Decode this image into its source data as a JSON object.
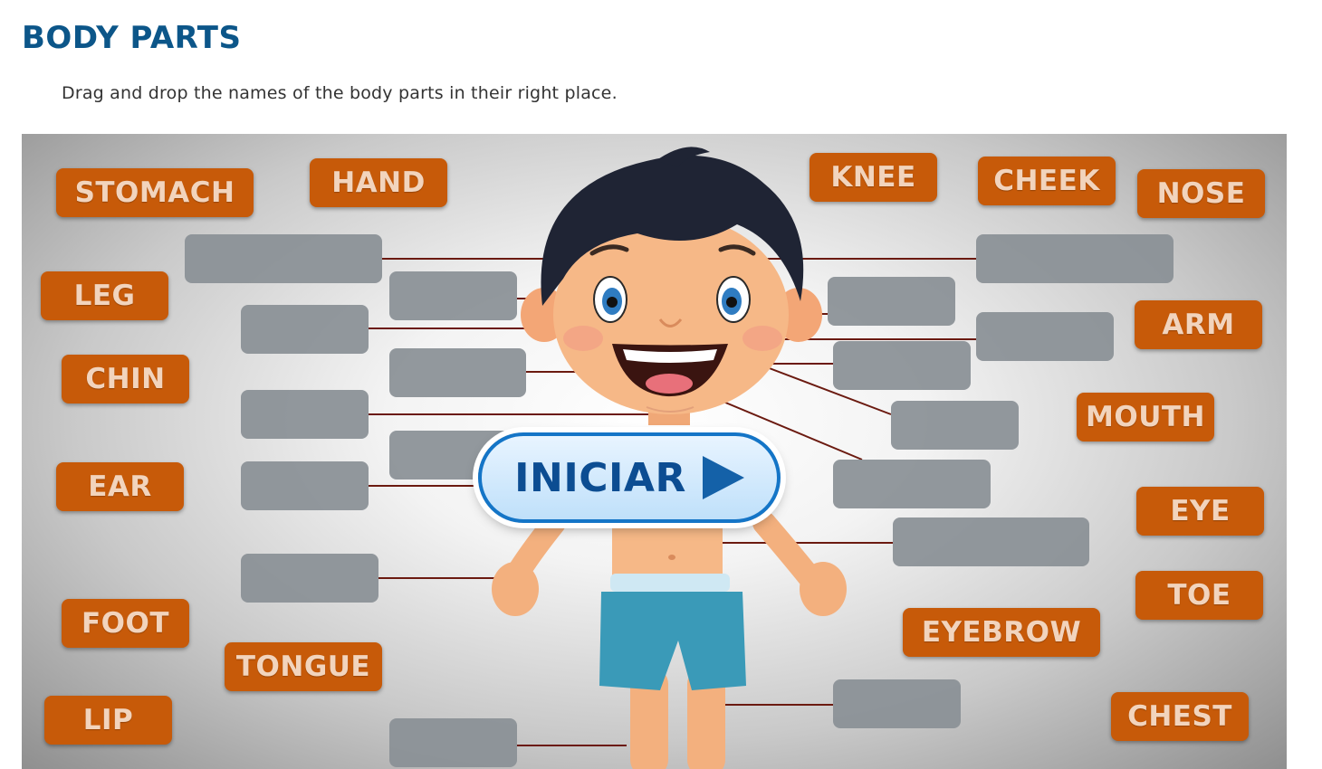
{
  "page": {
    "title": "BODY PARTS",
    "instructions": "Drag and drop the names of the body parts in their right place."
  },
  "activity": {
    "start_button_label": "INICIAR",
    "play_icon": "play-triangle-icon",
    "word_tiles": [
      "STOMACH",
      "HAND",
      "KNEE",
      "CHEEK",
      "NOSE",
      "LEG",
      "ARM",
      "CHIN",
      "MOUTH",
      "EAR",
      "EYE",
      "FOOT",
      "TOE",
      "EYEBROW",
      "TONGUE",
      "LIP",
      "CHEST"
    ],
    "drop_slot_count": 18
  },
  "colors": {
    "title": "#0c5689",
    "tile_background": "#c75a09",
    "tile_text": "#f2d4bd",
    "slot": "#8a9096",
    "button_border": "#1475c7",
    "button_text": "#0c4d92"
  }
}
